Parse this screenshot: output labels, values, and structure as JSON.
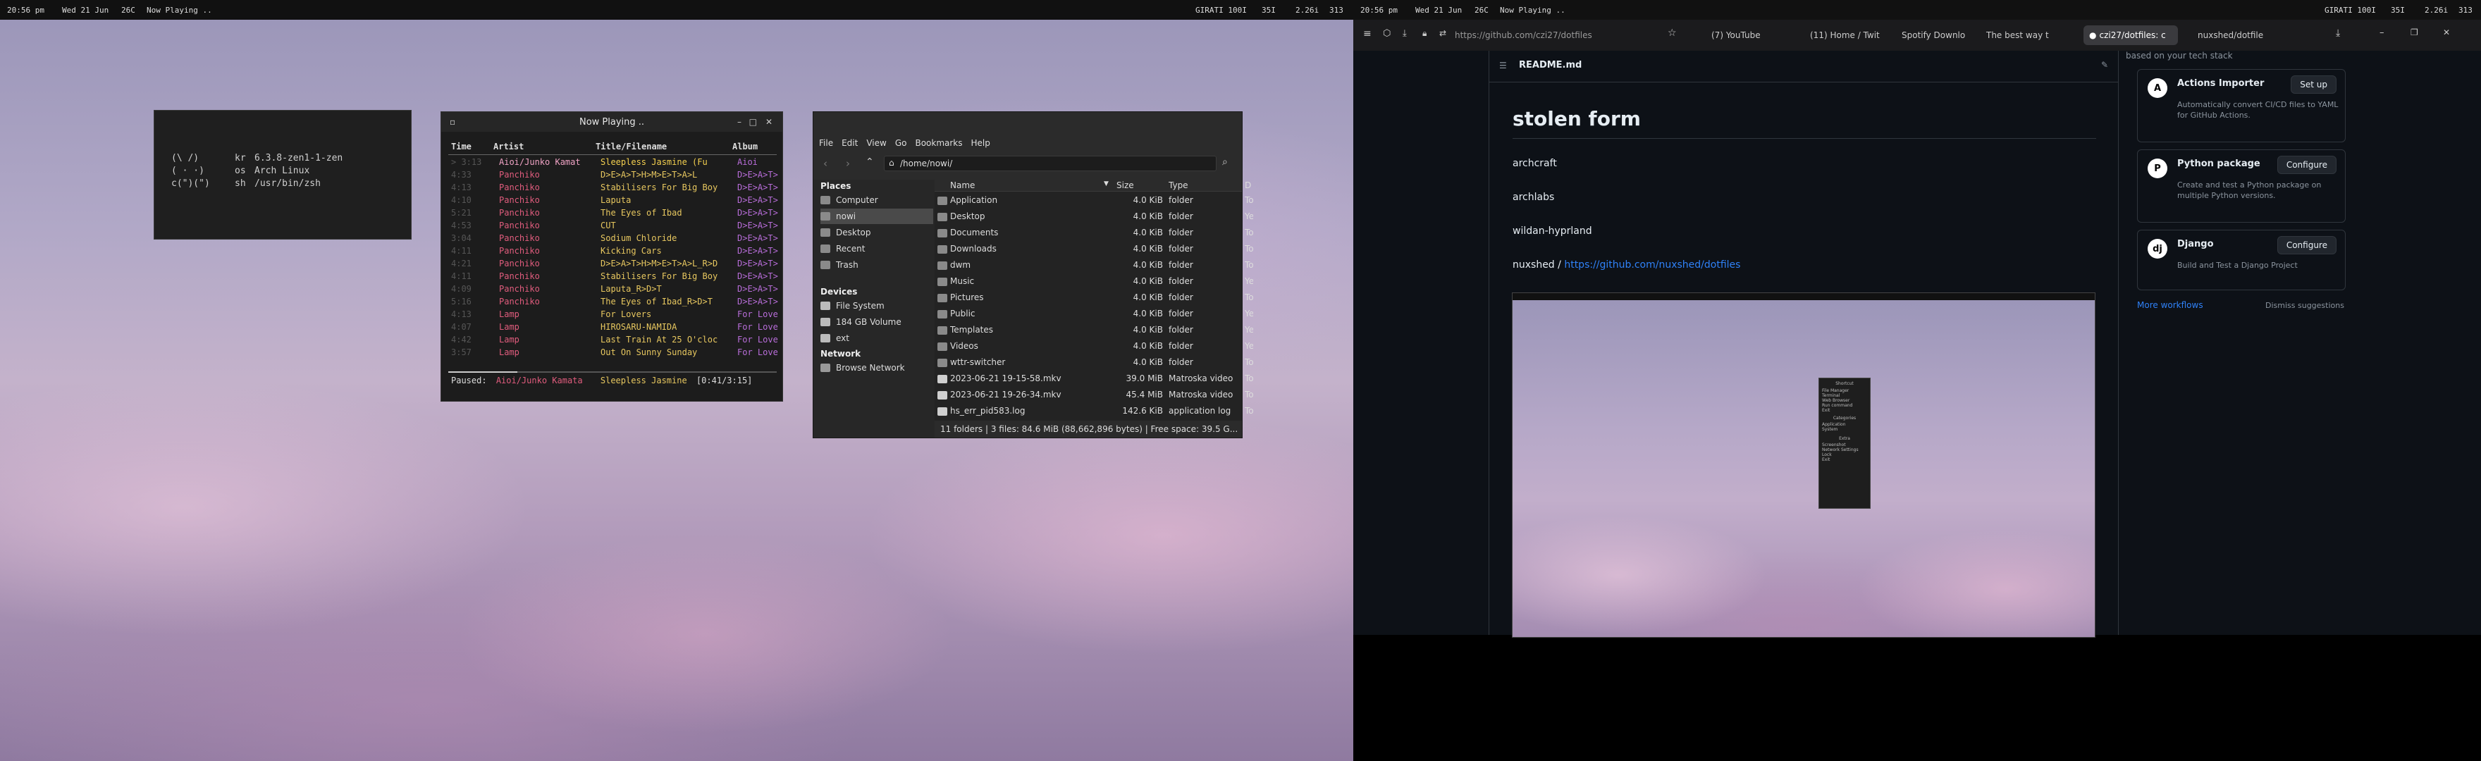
{
  "bar1": {
    "time": "20:56 pm",
    "date": "Wed 21 Jun",
    "temp": "26C",
    "playing": "Now Playing ..",
    "ws1": "GIRATI 100I",
    "ws2": "35I",
    "ws3": "2.26i",
    "ws4": "313"
  },
  "fetch": {
    "ascii1": "(\\ /)",
    "ascii2": "( · ·)",
    "ascii3": "c(\")(\")",
    "k1": "kr",
    "v1": "6.3.8-zen1-1-zen",
    "k2": "os",
    "v2": "Arch Linux",
    "k3": "sh",
    "v3": "/usr/bin/zsh"
  },
  "player": {
    "title": "Now Playing ..",
    "headers": {
      "time": "Time",
      "artist": "Artist",
      "title": "Title/Filename",
      "album": "Album"
    },
    "rows": [
      {
        "time": "> 3:13",
        "artist": "Aioi/Junko Kamat",
        "title": "Sleepless Jasmine (Fu",
        "album": "Aioi"
      },
      {
        "time": "4:33",
        "artist": "Panchiko",
        "title": "D>E>A>T>H>M>E>T>A>L",
        "album": "D>E>A>T>"
      },
      {
        "time": "4:13",
        "artist": "Panchiko",
        "title": "Stabilisers For Big Boy",
        "album": "D>E>A>T>"
      },
      {
        "time": "4:10",
        "artist": "Panchiko",
        "title": "Laputa",
        "album": "D>E>A>T>"
      },
      {
        "time": "5:21",
        "artist": "Panchiko",
        "title": "The Eyes of Ibad",
        "album": "D>E>A>T>"
      },
      {
        "time": "4:53",
        "artist": "Panchiko",
        "title": "CUT",
        "album": "D>E>A>T>"
      },
      {
        "time": "3:04",
        "artist": "Panchiko",
        "title": "Sodium Chloride",
        "album": "D>E>A>T>"
      },
      {
        "time": "4:11",
        "artist": "Panchiko",
        "title": "Kicking Cars",
        "album": "D>E>A>T>"
      },
      {
        "time": "4:21",
        "artist": "Panchiko",
        "title": "D>E>A>T>H>M>E>T>A>L_R>D",
        "album": "D>E>A>T>"
      },
      {
        "time": "4:11",
        "artist": "Panchiko",
        "title": "Stabilisers For Big Boy",
        "album": "D>E>A>T>"
      },
      {
        "time": "4:09",
        "artist": "Panchiko",
        "title": "Laputa_R>D>T",
        "album": "D>E>A>T>"
      },
      {
        "time": "5:16",
        "artist": "Panchiko",
        "title": "The Eyes of Ibad_R>D>T",
        "album": "D>E>A>T>"
      },
      {
        "time": "4:13",
        "artist": "Lamp",
        "title": "For Lovers",
        "album": "For Love"
      },
      {
        "time": "4:07",
        "artist": "Lamp",
        "title": "HIROSARU-NAMIDA",
        "album": "For Love"
      },
      {
        "time": "4:42",
        "artist": "Lamp",
        "title": "Last Train At 25 O'cloc",
        "album": "For Love"
      },
      {
        "time": "3:57",
        "artist": "Lamp",
        "title": "Out On Sunny Sunday",
        "album": "For Love"
      }
    ],
    "status_label": "Paused:",
    "status_artist": "Aioi/Junko Kamata",
    "status_title": "Sleepless Jasmine",
    "status_time": "[0:41/3:15]"
  },
  "fm": {
    "menu": [
      "File",
      "Edit",
      "View",
      "Go",
      "Bookmarks",
      "Help"
    ],
    "path": "/home/nowi/",
    "places_label": "Places",
    "places": [
      "Computer",
      "nowi",
      "Desktop",
      "Recent",
      "Trash"
    ],
    "devices_label": "Devices",
    "devices": [
      "File System",
      "184 GB Volume",
      "ext"
    ],
    "network_label": "Network",
    "network": [
      "Browse Network"
    ],
    "cols": {
      "name": "Name",
      "size": "Size",
      "type": "Type",
      "date": "D"
    },
    "files": [
      {
        "name": "Application",
        "size": "4.0 KiB",
        "type": "folder",
        "date": "To",
        "icon": "folder"
      },
      {
        "name": "Desktop",
        "size": "4.0 KiB",
        "type": "folder",
        "date": "Ye",
        "icon": "folder"
      },
      {
        "name": "Documents",
        "size": "4.0 KiB",
        "type": "folder",
        "date": "To",
        "icon": "folder"
      },
      {
        "name": "Downloads",
        "size": "4.0 KiB",
        "type": "folder",
        "date": "To",
        "icon": "folder"
      },
      {
        "name": "dwm",
        "size": "4.0 KiB",
        "type": "folder",
        "date": "To",
        "icon": "folder"
      },
      {
        "name": "Music",
        "size": "4.0 KiB",
        "type": "folder",
        "date": "Ye",
        "icon": "folder"
      },
      {
        "name": "Pictures",
        "size": "4.0 KiB",
        "type": "folder",
        "date": "To",
        "icon": "folder"
      },
      {
        "name": "Public",
        "size": "4.0 KiB",
        "type": "folder",
        "date": "Ye",
        "icon": "folder"
      },
      {
        "name": "Templates",
        "size": "4.0 KiB",
        "type": "folder",
        "date": "Ye",
        "icon": "folder"
      },
      {
        "name": "Videos",
        "size": "4.0 KiB",
        "type": "folder",
        "date": "Ye",
        "icon": "folder"
      },
      {
        "name": "wttr-switcher",
        "size": "4.0 KiB",
        "type": "folder",
        "date": "To",
        "icon": "folder"
      },
      {
        "name": "2023-06-21 19-15-58.mkv",
        "size": "39.0 MiB",
        "type": "Matroska video",
        "date": "To",
        "icon": "file"
      },
      {
        "name": "2023-06-21 19-26-34.mkv",
        "size": "45.4 MiB",
        "type": "Matroska video",
        "date": "To",
        "icon": "file"
      },
      {
        "name": "hs_err_pid583.log",
        "size": "142.6 KiB",
        "type": "application log",
        "date": "To",
        "icon": "file"
      }
    ],
    "status": "11 folders  |  3 files: 84.6 MiB (88,662,896 bytes)  |  Free space: 39.5 G..."
  },
  "bar2": {
    "time": "20:56 pm",
    "date": "Wed 21 Jun",
    "temp": "26C",
    "playing": "Now Playing ..",
    "ws1": "GIRATI 100I",
    "ws2": "35I",
    "ws3": "2.26i",
    "ws4": "313"
  },
  "browser": {
    "url": "https://github.com/czi27/dotfiles",
    "tabs": [
      "(7) YouTube",
      "(11) Home / Twit",
      "Spotify Downlo",
      "The best way t",
      "czi27/dotfiles: c",
      "nuxshed/dotfile"
    ],
    "readme_label": "README.md",
    "heading": "stolen form",
    "items": [
      "archcraft",
      "archlabs",
      "wildan-hyprland"
    ],
    "credit_text": "nuxshed / ",
    "credit_link": "https://github.com/nuxshed/dotfiles",
    "side_top": "based on your tech stack",
    "cards": [
      {
        "name": "Actions Importer",
        "desc": "Automatically convert CI/CD files to YAML for GitHub Actions.",
        "btn": "Set up",
        "logo": "A"
      },
      {
        "name": "Python package",
        "desc": "Create and test a Python package on multiple Python versions.",
        "btn": "Configure",
        "logo": "P"
      },
      {
        "name": "Django",
        "desc": "Build and Test a Django Project",
        "btn": "Configure",
        "logo": "dj"
      }
    ],
    "more_workflows": "More workflows",
    "dismiss": "Dismiss suggestions",
    "menu_title": "Shortcut",
    "menu_items": [
      "File Manager",
      "Terminal",
      "Web Browser",
      "Run command",
      "Exit"
    ],
    "menu_cat": "Categories",
    "menu_cat_items": [
      "Application",
      "System"
    ],
    "menu_extra": "Extra",
    "menu_extra_items": [
      "Screenshot",
      "Network Settings",
      "Lock",
      "Exit"
    ]
  },
  "colors": {
    "accent": "#2f81f7",
    "panchiko": "#e05c7d",
    "title": "#e7c75f",
    "album": "#b86dd9",
    "folder": "#8a8a8a"
  }
}
